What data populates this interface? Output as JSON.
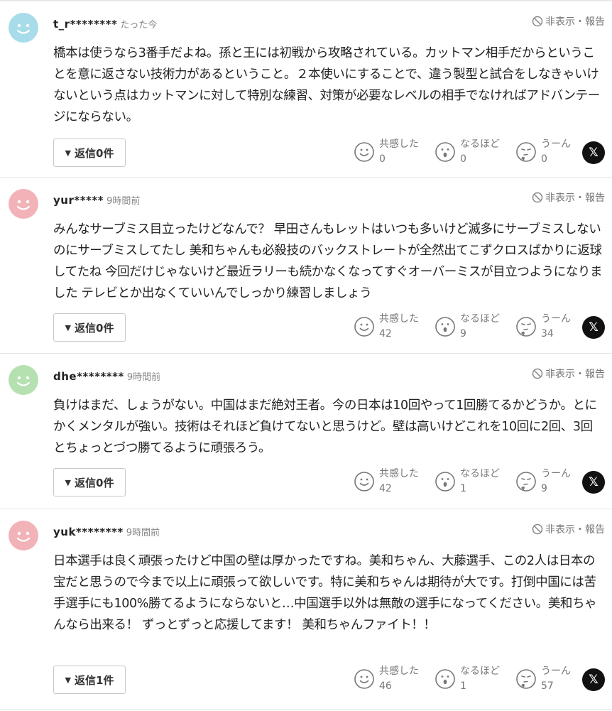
{
  "labels": {
    "hide_report": "非表示・報告",
    "empathy": "共感した",
    "insight": "なるほど",
    "hmm": "うーん",
    "x_share": "𝕏"
  },
  "colors": {
    "avatar_blue": "#a8dcea",
    "avatar_pink": "#f2b3b8",
    "avatar_green": "#b5e0b0"
  },
  "comments": [
    {
      "user": "t_r********",
      "time": "たった今",
      "text": "橋本は使うなら3番手だよね。孫と王には初戦から攻略されている。カットマン相手だからということを意に返さない技術力があるということ。２本使いにすることで、違う製型と試合をしなきゃいけないという点はカットマンに対して特別な練習、対策が必要なレベルの相手でなければアドバンテージにならない。",
      "reply": "返信0件",
      "empathy": "0",
      "insight": "0",
      "hmm": "0"
    },
    {
      "user": "yur*****",
      "time": "9時間前",
      "text": "みんなサーブミス目立ったけどなんで？ 早田さんもレットはいつも多いけど滅多にサーブミスしないのにサーブミスしてたし 美和ちゃんも必殺技のバックストレートが全然出てこずクロスばかりに返球してたね 今回だけじゃないけど最近ラリーも続かなくなってすぐオーバーミスが目立つようになりました テレビとか出なくていいんでしっかり練習しましょう",
      "reply": "返信0件",
      "empathy": "42",
      "insight": "9",
      "hmm": "34"
    },
    {
      "user": "dhe********",
      "time": "9時間前",
      "text": "負けはまだ、しょうがない。中国はまだ絶対王者。今の日本は10回やって1回勝てるかどうか。とにかくメンタルが強い。技術はそれほど負けてないと思うけど。壁は高いけどこれを10回に2回、3回とちょっとづつ勝てるように頑張ろう。",
      "reply": "返信0件",
      "empathy": "42",
      "insight": "1",
      "hmm": "9"
    },
    {
      "user": "yuk********",
      "time": "9時間前",
      "text": "日本選手は良く頑張ったけど中国の壁は厚かったですね。美和ちゃん、大藤選手、この2人は日本の宝だと思うので今まで以上に頑張って欲しいです。特に美和ちゃんは期待が大です。打倒中国には苦手選手にも100%勝てるようにならないと…中国選手以外は無敵の選手になってください。美和ちゃんなら出来る！ ずっとずっと応援してます！ 美和ちゃんファイト！！",
      "reply": "返信1件",
      "empathy": "46",
      "insight": "1",
      "hmm": "57"
    }
  ]
}
